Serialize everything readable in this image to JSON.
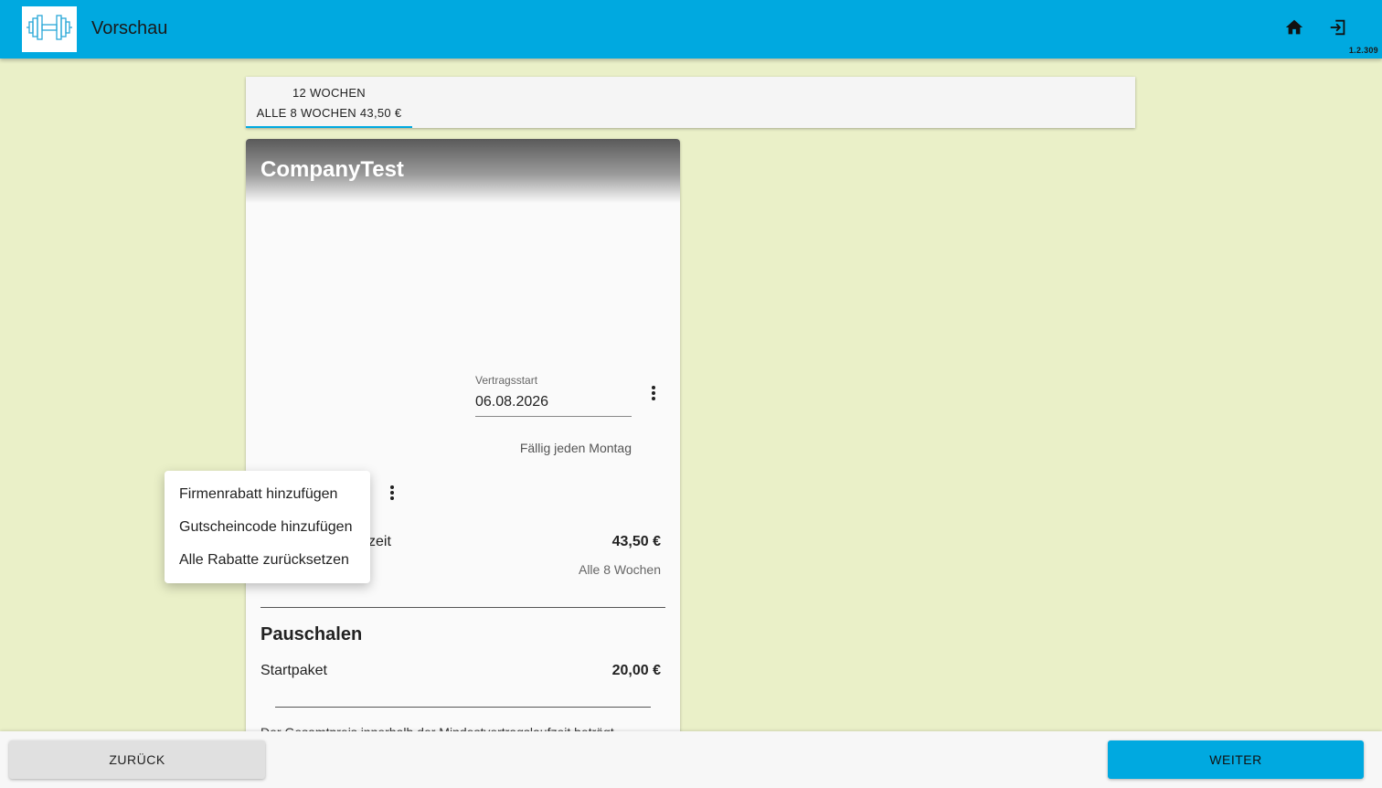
{
  "app": {
    "title": "Vorschau",
    "version": "1.2.309",
    "logo_icon": "dumbbell-icon"
  },
  "toolbar": {
    "home_icon": "home-icon",
    "logout_icon": "logout-icon"
  },
  "tabs": [
    {
      "line1": "12 WOCHEN",
      "line2": "ALLE 8 WOCHEN 43,50 €",
      "selected": true
    }
  ],
  "card": {
    "title": "CompanyTest",
    "contract_start_label": "Vertragsstart",
    "contract_start_value": "06.08.2026",
    "due_text": "Fällig jeden Montag",
    "row_label_partial": "zeit",
    "row_price": "43,50 €",
    "row_sub": "Alle 8 Wochen",
    "section_title": "Pauschalen",
    "item_label": "Startpaket",
    "item_price": "20,00 €",
    "total_text": "Der Gesamtpreis innerhalb der Mindestvertragslaufzeit beträgt"
  },
  "menu": {
    "items": [
      "Firmenrabatt hinzufügen",
      "Gutscheincode hinzufügen",
      "Alle Rabatte zurücksetzen"
    ]
  },
  "footer": {
    "back_label": "ZURÜCK",
    "next_label": "WEITER"
  },
  "colors": {
    "primary": "#00a9e0",
    "background": "#eaf0c8"
  }
}
